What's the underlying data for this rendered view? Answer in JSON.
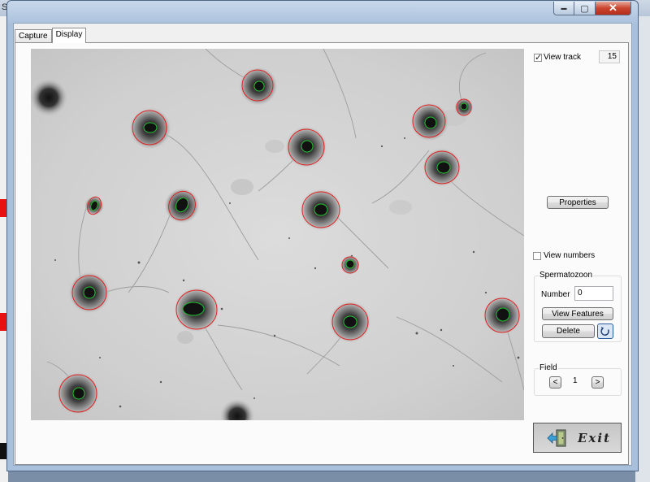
{
  "background": {
    "titlebar_text": "Sp"
  },
  "window": {
    "controls": {
      "minimize": "▬",
      "maximize": "▢",
      "close": "✕"
    }
  },
  "tabs": [
    {
      "label": "Capture",
      "active": false
    },
    {
      "label": "Display",
      "active": true
    }
  ],
  "view_track": {
    "label": "View track",
    "checked": true,
    "count": "15"
  },
  "properties_button": "Properties",
  "view_numbers": {
    "label": "View numbers",
    "checked": false
  },
  "spermatozoon": {
    "title": "Spermatozoon",
    "number_label": "Number",
    "number_value": "0",
    "view_features_button": "View Features",
    "delete_button": "Delete",
    "refresh_icon": "undo-icon"
  },
  "field": {
    "title": "Field",
    "prev": "<",
    "value": "1",
    "next": ">"
  },
  "exit_button": {
    "label": "Exit",
    "icon": "exit-door-icon"
  },
  "colors": {
    "contour_outer": "#e02020",
    "contour_inner": "#22c030",
    "close_button": "#c9452f"
  }
}
